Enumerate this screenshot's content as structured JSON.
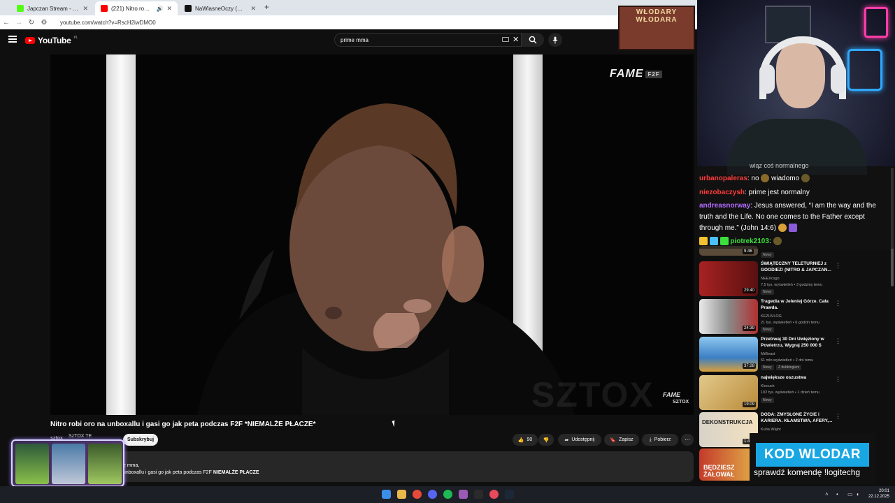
{
  "browser": {
    "tabs": [
      {
        "title": "Japczan Stream - Watch Live on",
        "color": "#53fc18",
        "active": false
      },
      {
        "title": "(221) Nitro robi oro na unb",
        "color": "#ff0000",
        "active": true
      },
      {
        "title": "NaWlasneOczy (@na_wlasne_o",
        "color": "#111111",
        "active": false
      }
    ],
    "url": "youtube.com/watch?v=RscH2iwDMO0"
  },
  "youtube": {
    "logo": "YouTube",
    "region": "PL",
    "search_value": "prime mma",
    "video": {
      "brand": "FAME",
      "brand_tag": "F2F",
      "watermark": "SZTOX",
      "corner_brand": "FAME",
      "corner_sub": "SZTOX",
      "title": "Nitro robi oro na unboxallu i gasi go jak peta podczas F2F *NIEMALŻE PŁACZE*",
      "channel_short": "sztox",
      "channel_label": "SzTOX TE",
      "subscribe_label": "Subskrybuj",
      "likes": "90",
      "share_label": "Udostępnij",
      "save_label": "Zapisz",
      "download_label": "Pobierz",
      "desc_line1": "e mma,",
      "desc_line2_pre": "unboxallu i gasi go jak peta podczas F2F ",
      "desc_line2_bold": "NIEMALŻE PŁACZE"
    },
    "recommended": [
      {
        "title": "",
        "channel": "",
        "meta": "",
        "duration": "9:46",
        "badge": "Nowy",
        "thumb": "#5a4a3a"
      },
      {
        "title": "ŚWIĄTECZNY TELETURNIEJ z GOODIEZ! (NITRO & JAPCZAN...",
        "channel": "NEEXcsgo",
        "meta": "7,5 tys. wyświetleń • 3 godziny temu",
        "duration": "29:40",
        "badge": "Nowy",
        "thumb": "#8a1f1f"
      },
      {
        "title": "Tragedia w Jeleniej Górze. Cała Prawda.",
        "channel": "KEZUVLOG",
        "meta": "21 tys. wyświetleń • 6 godzin temu",
        "duration": "24:39",
        "badge": "Nowy",
        "thumb": "#6a6a6a"
      },
      {
        "title": "Przetrwaj 30 Dni Uwięziony w Powietrzu, Wygraj 250 000 $",
        "channel": "MrBeast",
        "meta": "61 mln wyświetleń • 2 dni temu",
        "duration": "37:28",
        "badge": "Nowy",
        "badge2": "Z dubbingiem",
        "thumb": "#3b7fc4"
      },
      {
        "title": "największe oszustwa",
        "channel": "Klocuch",
        "meta": "102 tys. wyświetleń • 1 dzień temu",
        "duration": "19:09",
        "badge": "Nowy",
        "thumb": "#c9a25a"
      },
      {
        "title": "DODA: ZMYSŁONE ŻYCIE i KARIERA. KŁAMSTWA, AFERY,...",
        "channel": "Kuba Wątor",
        "meta": "",
        "duration": "1:46",
        "badge": "",
        "thumb": "#b9b2a8",
        "thumb_text": "DEKONSTRUKCJA"
      },
      {
        "title": "",
        "channel": "",
        "meta": "",
        "duration": "",
        "badge": "",
        "thumb": "#c43b2a",
        "thumb_text": "BĘDZIESZ ŻAŁOWAŁ"
      }
    ]
  },
  "overlay": {
    "poster_text": "WŁODARY WŁODARA",
    "chat": [
      {
        "user": "",
        "text": "wiąz coś normalnego"
      },
      {
        "user": "urbanopaleras",
        "text": ": no",
        "emote": "wiadomo"
      },
      {
        "user": "niezobaczysh",
        "text": ": prime jest normalny"
      },
      {
        "user": "andreasnorway",
        "text": ": Jesus answered, “I am the way and the"
      },
      {
        "user": "",
        "text": "truth and the Life. No one comes to the Father except"
      },
      {
        "user": "",
        "text": "through me.” (John 14:6)"
      },
      {
        "user": "piotrek2103",
        "text": ":"
      }
    ],
    "promo_code": "KOD WLODAR",
    "promo_text": "sprawdź komendę !logitechg"
  },
  "taskbar": {
    "time": "20:01",
    "date": "22.12.2025"
  },
  "colors": {
    "yt_red": "#ff0000",
    "promo_blue": "#19a7e3",
    "chat_red": "#ff3b3b",
    "chat_purple": "#b36cff",
    "chat_green": "#3ce03c"
  }
}
